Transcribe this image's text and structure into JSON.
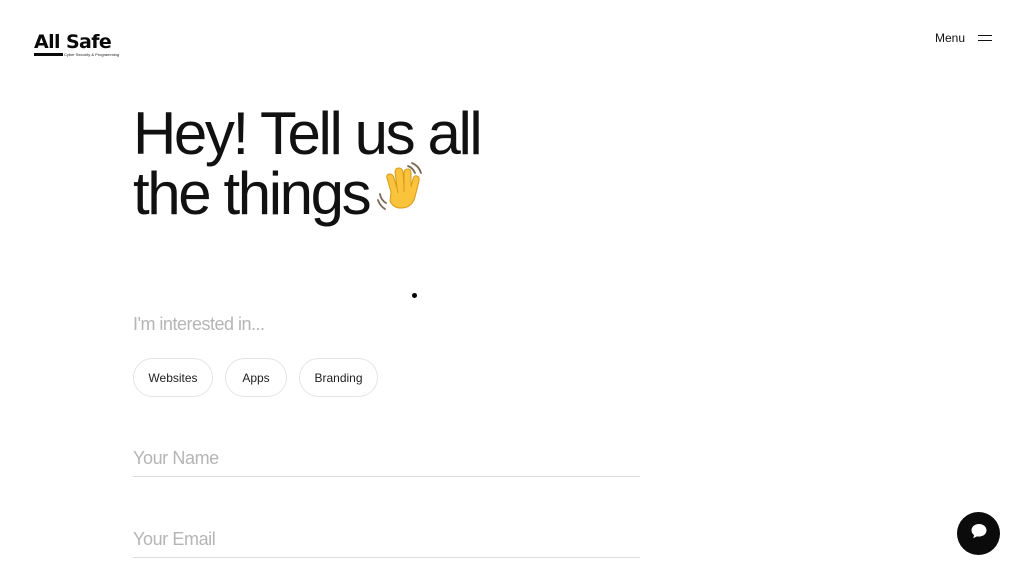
{
  "header": {
    "logo_text": "All Safe",
    "logo_tagline": "Cyber Security & Programming",
    "menu_label": "Menu",
    "menu_icon": "hamburger-icon"
  },
  "hero": {
    "headline_line1": "Hey! Tell us all",
    "headline_line2": "the things",
    "emoji": "waving-hand-icon"
  },
  "form": {
    "interest_label": "I'm interested in...",
    "interests": [
      "Websites",
      "Apps",
      "Branding"
    ],
    "name_placeholder": "Your Name",
    "email_placeholder": "Your Email"
  },
  "chat": {
    "icon": "chat-bubble-icon"
  },
  "colors": {
    "text": "#111111",
    "placeholder": "#b5b5b5",
    "chip_border": "#e4e4e4",
    "emoji_yellow": "#f9c33b",
    "chat_bg": "#0b0b0b"
  }
}
